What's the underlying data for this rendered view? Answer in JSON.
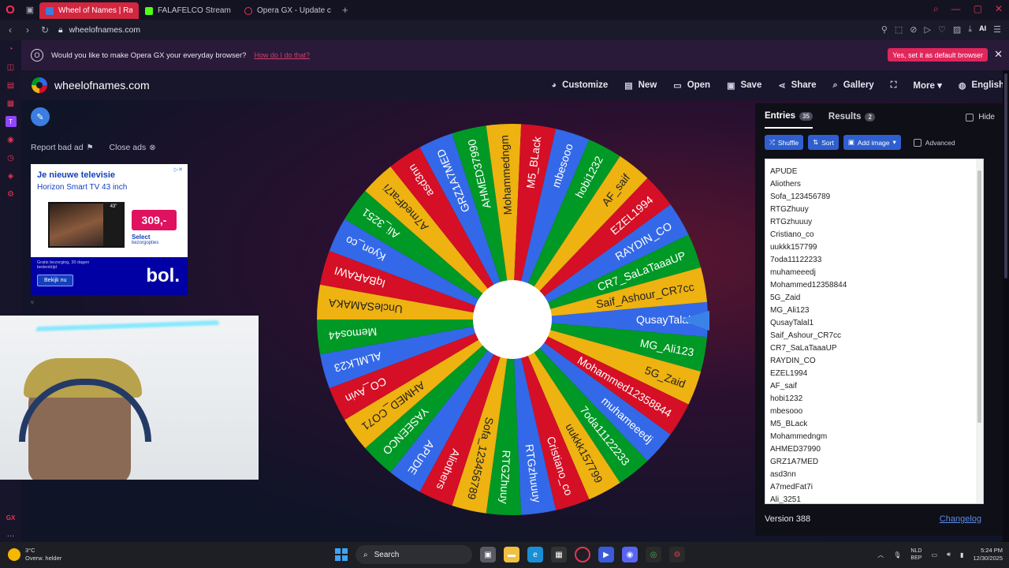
{
  "browser": {
    "tabs": [
      {
        "title": "Wheel of Names | Ran",
        "active": true,
        "favicon_color": "#3b7de0"
      },
      {
        "title": "FALAFELCO Stream - Wat",
        "active": false,
        "favicon_color": "#53fc18"
      },
      {
        "title": "Opera GX - Update comp",
        "active": false,
        "favicon_color": "#e53656"
      }
    ],
    "url": "wheelofnames.com",
    "ai_label": "AI"
  },
  "infobar": {
    "message": "Would you like to make Opera GX your everyday browser?",
    "how_link": "How do I do that?",
    "yes_button": "Yes, set it as default browser"
  },
  "site": {
    "name": "wheelofnames.com",
    "menu": [
      {
        "label": "Customize",
        "icon": "palette-icon",
        "glyph": "◕"
      },
      {
        "label": "New",
        "icon": "file-icon",
        "glyph": "▤"
      },
      {
        "label": "Open",
        "icon": "folder-icon",
        "glyph": "▭"
      },
      {
        "label": "Save",
        "icon": "floppy-icon",
        "glyph": "▣"
      },
      {
        "label": "Share",
        "icon": "share-icon",
        "glyph": "⋖"
      },
      {
        "label": "Gallery",
        "icon": "search-icon",
        "glyph": "⌕"
      },
      {
        "label": "",
        "icon": "fullscreen-icon",
        "glyph": "⛶"
      },
      {
        "label": "More ▾",
        "icon": "",
        "glyph": ""
      },
      {
        "label": "English",
        "icon": "globe-icon",
        "glyph": "◍"
      }
    ]
  },
  "ads": {
    "report": "Report bad ad",
    "close": "Close ads",
    "banner": {
      "headline": "Je nieuwe televisie",
      "subline": "Horizon Smart TV 43 inch",
      "size": "43\"",
      "price": "309,-",
      "select": "Select",
      "select_sub": "bezorgopties",
      "fine": "Gratis bezorging, 30 dagen bedenktijd",
      "cta": "Bekijk nu",
      "brand": "bol."
    }
  },
  "panel": {
    "tabs": [
      {
        "label": "Entries",
        "count": "35",
        "active": true
      },
      {
        "label": "Results",
        "count": "2",
        "active": false
      }
    ],
    "hide_label": "Hide",
    "toolbar": {
      "shuffle": "Shuffle",
      "sort": "Sort",
      "add_image": "Add image",
      "advanced": "Advanced"
    },
    "entries": [
      "APUDE",
      "Aliothers",
      "Sofa_123456789",
      "RTGZhuuy",
      "RTGzhuuuy",
      "Cristiano_co",
      "uukkk157799",
      "7oda11122233",
      "muhameeedj",
      "Mohammed12358844",
      "5G_Zaid",
      "MG_Ali123",
      "QusayTalal1",
      "Saif_Ashour_CR7cc",
      "CR7_SaLaTaaaUP",
      "RAYDIN_CO",
      "EZEL1994",
      "AF_saif",
      "hobi1232",
      "mbesooo",
      "M5_BLack",
      "Mohammedngm",
      "AHMED37990",
      "GRZ1A7MED",
      "asd3nn",
      "A7medFat7i",
      "Ali_3251"
    ],
    "version": "Version 388",
    "changelog": "Changelog"
  },
  "wheel": {
    "colors": [
      "#3369e8",
      "#009925",
      "#eeb211",
      "#d50f25"
    ],
    "slices": [
      "QusayTalal1",
      "MG_Ali123",
      "5G_Zaid",
      "Mohammed12358844",
      "muhameeedj",
      "7oda11122233",
      "uukkk157799",
      "Cristiano_co",
      "RTGzhuuuy",
      "RTGZhuuy",
      "Sofa_123456789",
      "Aliothers",
      "APUDE",
      "YASEENCO",
      "AHMED_CO71",
      "CO_Avin",
      "ALMLK23",
      "Memos44",
      "UncleSAMAKA",
      "IqBARAWI",
      "Kyon_co",
      "Ali_3251",
      "A7medFat7i",
      "asd3nn",
      "GRZ1A7MED",
      "AHMED37990",
      "Mohammedngm",
      "M5_BLack",
      "mbesooo",
      "hobi1232",
      "AF_saif",
      "EZEL1994",
      "RAYDIN_CO",
      "CR7_SaLaTaaaUP",
      "Saif_Ashour_CR7cc"
    ]
  },
  "taskbar": {
    "temp": "3°C",
    "condition": "Overw. helder",
    "search": "Search",
    "lang1": "NLD",
    "lang2": "BEP",
    "time": "5:24 PM",
    "date": "12/30/2025"
  }
}
